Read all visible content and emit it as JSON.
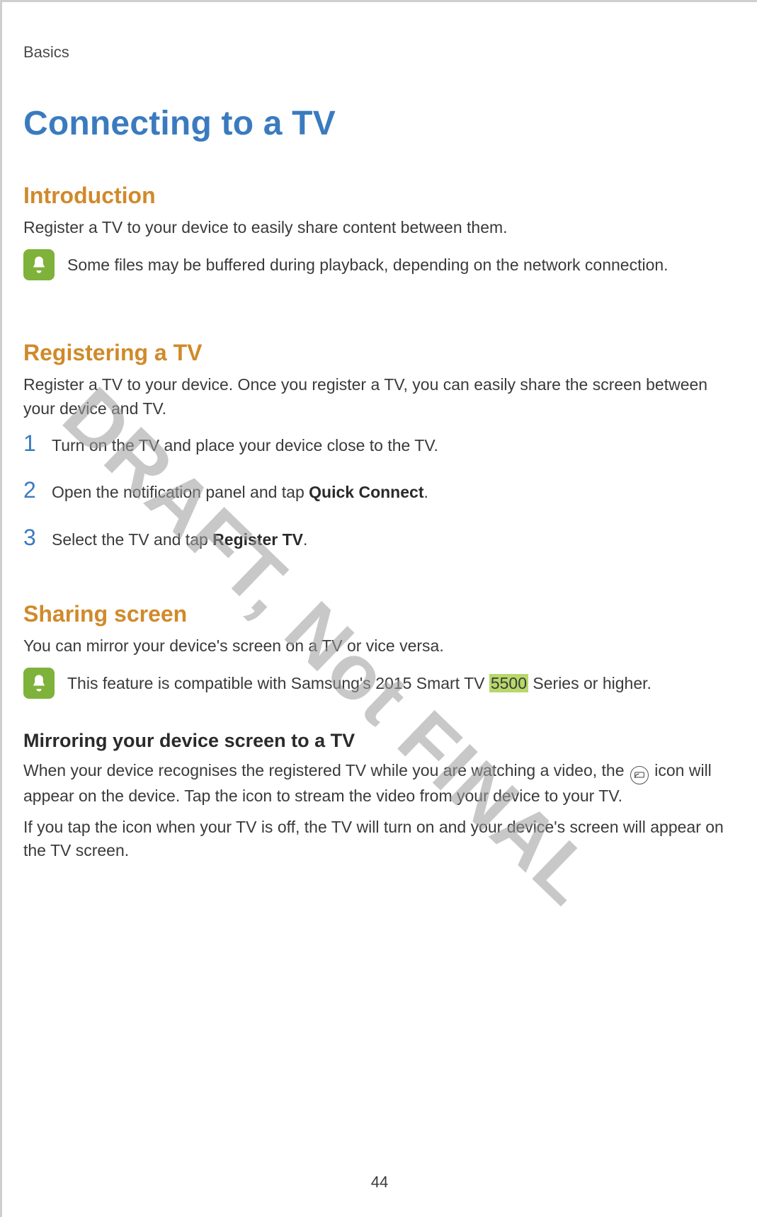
{
  "header": "Basics",
  "title": "Connecting to a TV",
  "watermark": "DRAFT, Not FINAL",
  "page_number": "44",
  "intro": {
    "heading": "Introduction",
    "text": "Register a TV to your device to easily share content between them.",
    "note": "Some files may be buffered during playback, depending on the network connection."
  },
  "register": {
    "heading": "Registering a TV",
    "text": "Register a TV to your device. Once you register a TV, you can easily share the screen between your device and TV.",
    "steps": [
      {
        "num": "1",
        "pre": "Turn on the TV and place your device close to the TV."
      },
      {
        "num": "2",
        "pre": "Open the notification panel and tap ",
        "bold": "Quick Connect",
        "post": "."
      },
      {
        "num": "3",
        "pre": "Select the TV and tap ",
        "bold": "Register TV",
        "post": "."
      }
    ]
  },
  "sharing": {
    "heading": "Sharing screen",
    "text": "You can mirror your device's screen on a TV or vice versa.",
    "note_pre": "This feature is compatible with Samsung's 2015 Smart TV ",
    "note_hl": "5500",
    "note_post": " Series or higher.",
    "sub_heading": "Mirroring your device screen to a TV",
    "para1_pre": "When your device recognises the registered TV while you are watching a video, the ",
    "para1_post": " icon will appear on the device. Tap the icon to stream the video from your device to your TV.",
    "para2": "If you tap the icon when your TV is off, the TV will turn on and your device's screen will appear on the TV screen."
  }
}
